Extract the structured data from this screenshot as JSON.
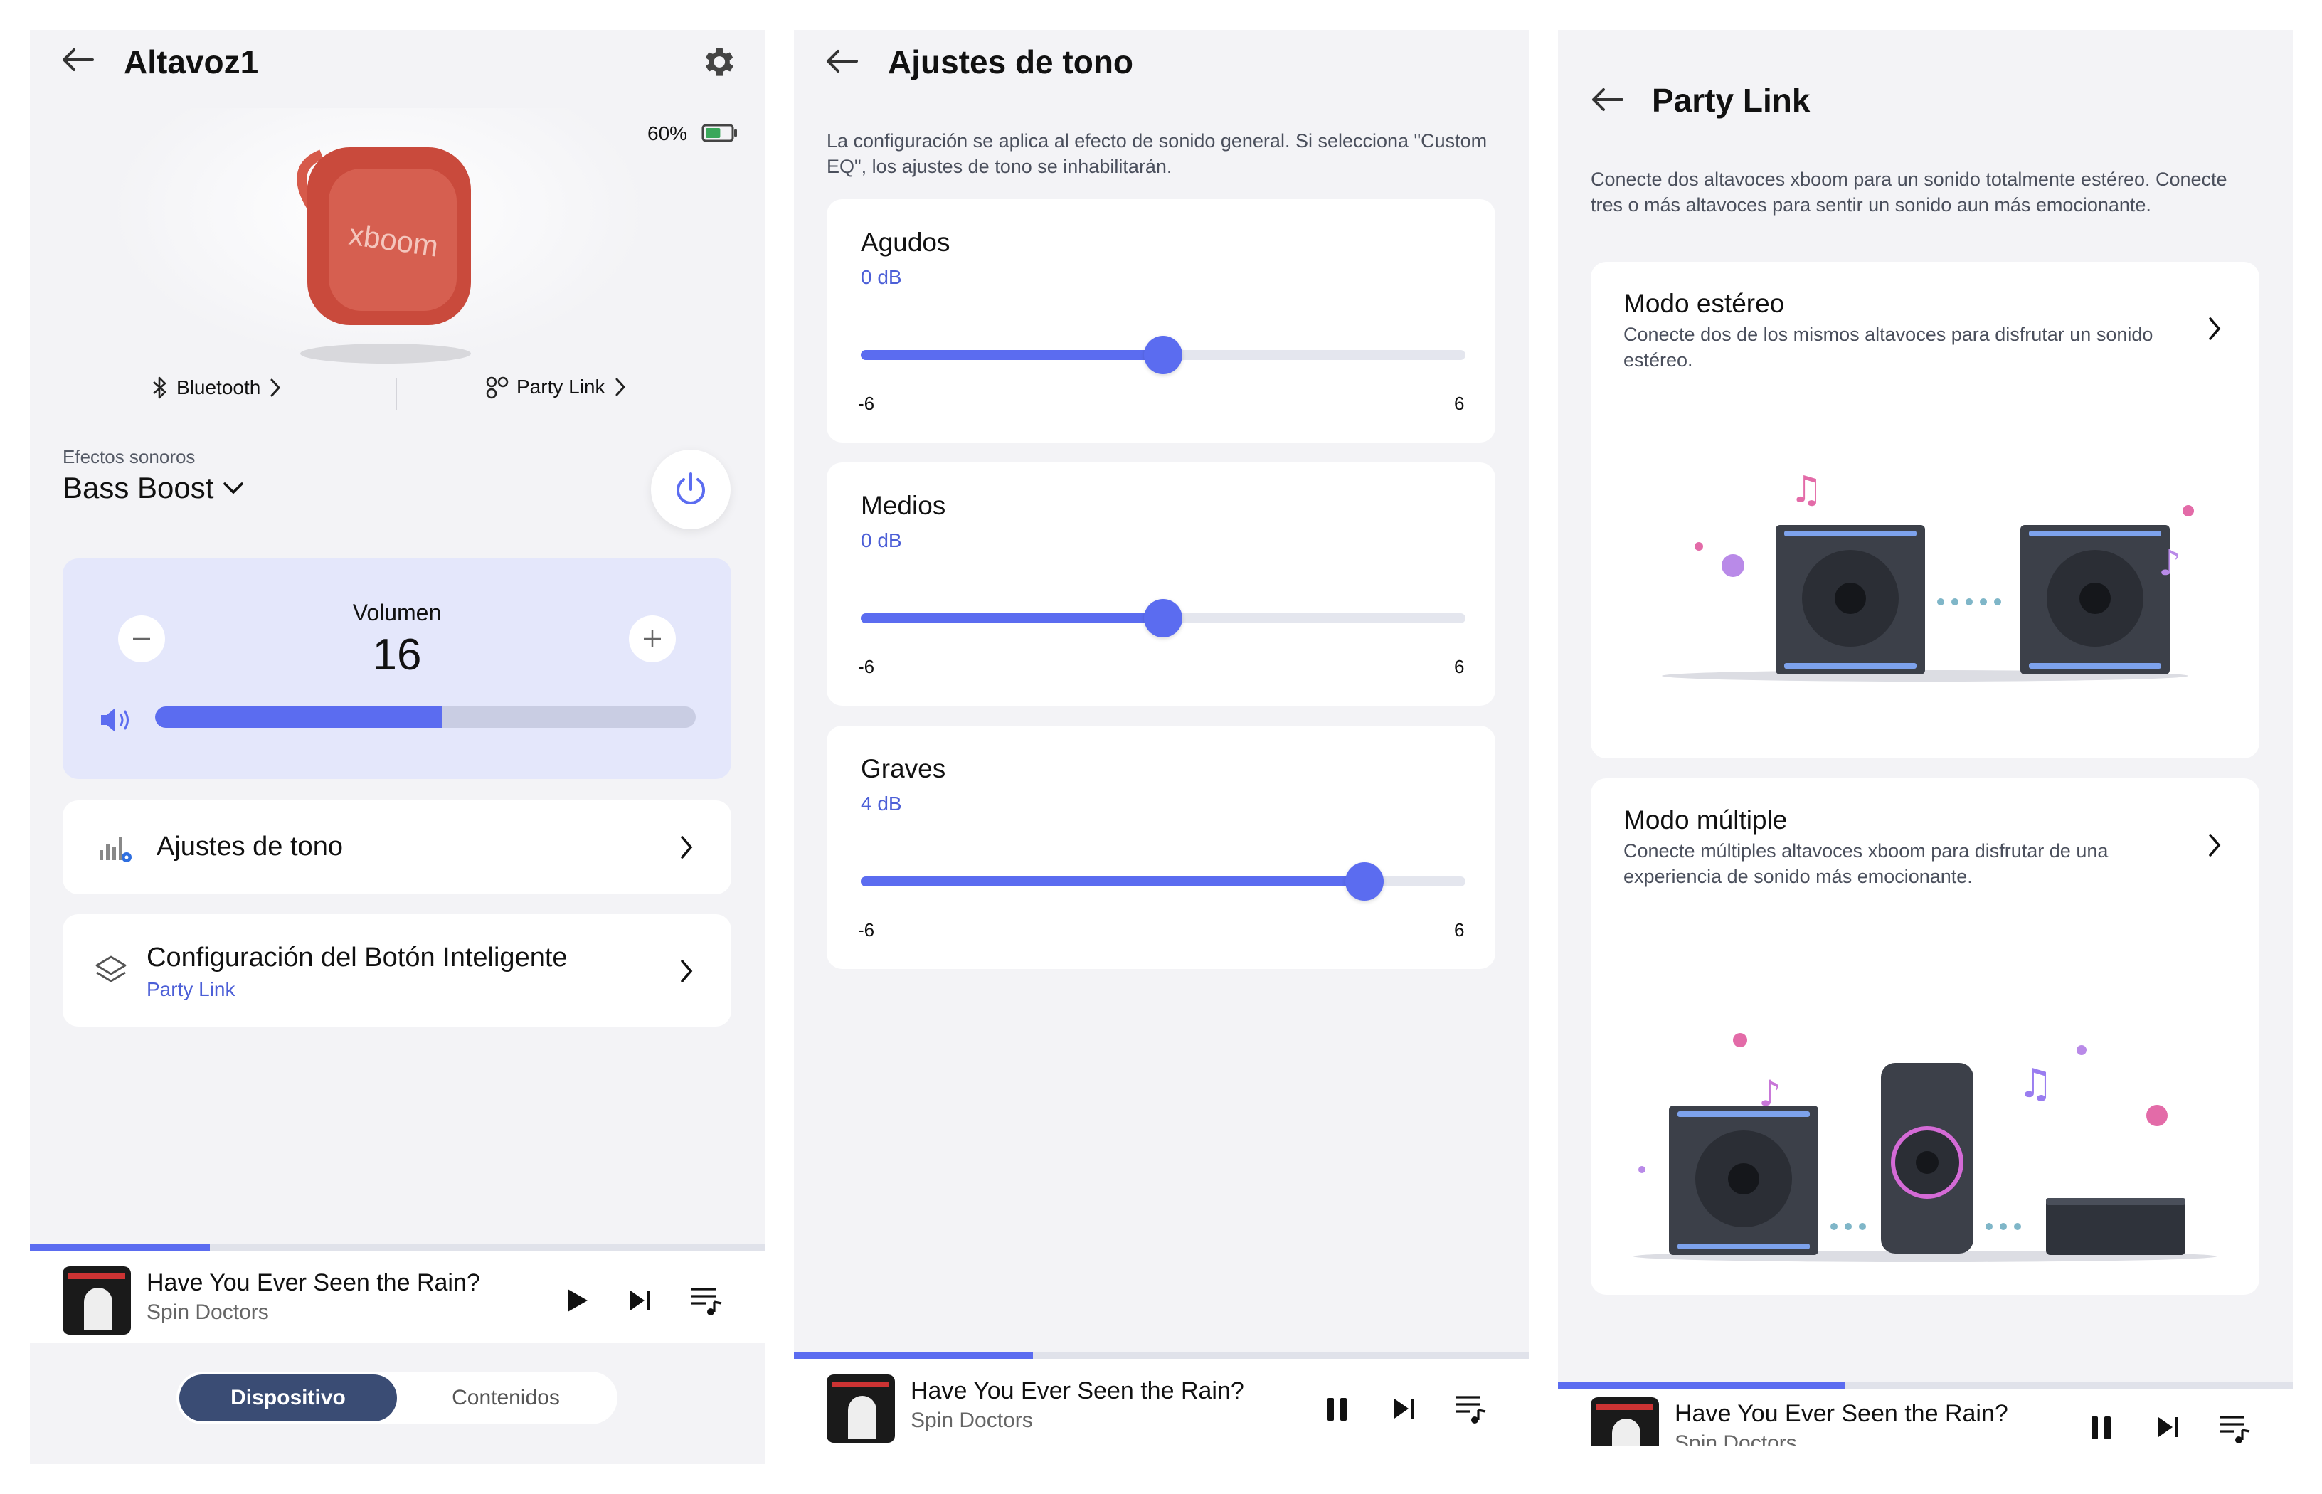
{
  "device": {
    "title": "Altavoz1",
    "battery": "60%",
    "battery_level": 0.6,
    "bluetooth_label": "Bluetooth",
    "partylink_label": "Party Link",
    "speaker_brand": "xboom",
    "effects_label": "Efectos sonoros",
    "effects_value": "Bass Boost",
    "volume_label": "Volumen",
    "volume_value": "16",
    "volume_level": 0.53,
    "tone_label": "Ajustes de tono",
    "smart_button_label": "Configuración del Botón Inteligente",
    "smart_button_sub": "Party Link",
    "bottom_tabs": [
      "Dispositivo",
      "Contenidos"
    ],
    "active_tab": 0
  },
  "tone": {
    "title": "Ajustes de tono",
    "description": "La configuración se aplica al efecto de sonido general. Si selecciona \"Custom EQ\", los ajustes de tono se inhabilitarán.",
    "bands": [
      {
        "name": "Agudos",
        "value_label": "0 dB",
        "value": 0,
        "min_label": "-6",
        "max_label": "6"
      },
      {
        "name": "Medios",
        "value_label": "0 dB",
        "value": 0,
        "min_label": "-6",
        "max_label": "6"
      },
      {
        "name": "Graves",
        "value_label": "4 dB",
        "value": 4,
        "min_label": "-6",
        "max_label": "6"
      }
    ],
    "range": [
      -6,
      6
    ]
  },
  "party": {
    "title": "Party Link",
    "description": "Conecte dos altavoces xboom para un sonido totalmente estéreo. Conecte tres o más altavoces para sentir un sonido aun más emocionante.",
    "modes": [
      {
        "title": "Modo estéreo",
        "desc": "Conecte dos de los mismos altavoces para disfrutar un sonido estéreo."
      },
      {
        "title": "Modo múltiple",
        "desc": "Conecte múltiples altavoces xboom para disfrutar de una experiencia de sonido más emocionante."
      }
    ]
  },
  "player": {
    "song": "Have You Ever Seen the Rain?",
    "artist": "Spin Doctors",
    "progress_panels": [
      0.245,
      0.325,
      0.39
    ]
  },
  "colors": {
    "accent": "#5b6cf0",
    "volume_card": "#e4e7fb",
    "dark_tab": "#3a4c74"
  }
}
